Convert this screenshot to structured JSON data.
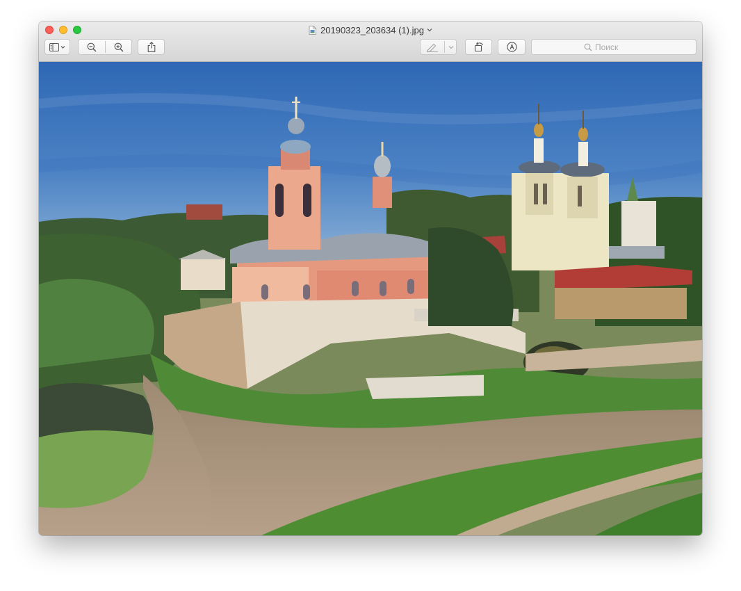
{
  "window": {
    "title": "20190323_203634 (1).jpg",
    "title_icon": "jpeg-document-icon"
  },
  "toolbar": {
    "sidebar_button_icon": "sidebar-icon",
    "zoom_out_icon": "zoom-out-icon",
    "zoom_in_icon": "zoom-in-icon",
    "share_icon": "share-icon",
    "markup_pen_icon": "pen-icon",
    "rotate_icon": "rotate-left-icon",
    "annotate_icon": "markup-icon"
  },
  "search": {
    "placeholder": "Поиск",
    "value": ""
  },
  "image": {
    "subject": "oil painting of hilltop church with bell towers and green meadows"
  },
  "colors": {
    "sky": "#3f74bc",
    "church_pink": "#e0967e",
    "grass": "#4e8a33",
    "path": "#b0987e"
  }
}
